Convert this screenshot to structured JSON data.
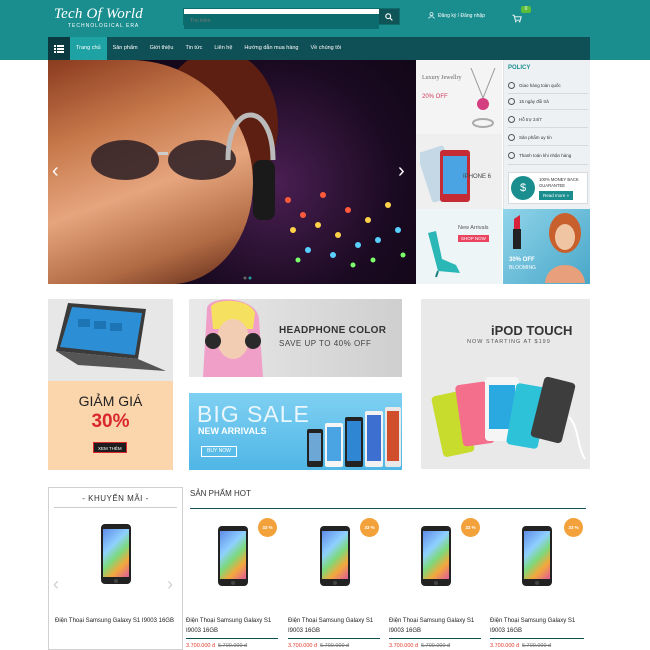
{
  "header": {
    "logo_title": "Tech Of World",
    "logo_subtitle": "TECHNOLOGICAL ERA",
    "search_placeholder": "Tìm kiếm",
    "account_text": "Đăng ký / Đăng nhập",
    "cart_count": "0"
  },
  "nav": {
    "items": [
      {
        "label": "Trang chủ"
      },
      {
        "label": "Sản phẩm"
      },
      {
        "label": "Giới thiệu"
      },
      {
        "label": "Tin tức"
      },
      {
        "label": "Liên hệ"
      },
      {
        "label": "Hướng dẫn mua hàng"
      },
      {
        "label": "Về chúng tôi"
      }
    ]
  },
  "side_banners": {
    "jewelry_title": "Luxury Jewellry",
    "jewelry_offer": "20% OFF",
    "iphone_label": "IPHONE 6",
    "new_arrivals": "New Arrivals",
    "shop_now": "SHOP NOW",
    "lipstick_offer": "30% OFF",
    "lipstick_label": "BLOOMING"
  },
  "policy": {
    "title": "POLICY",
    "items": [
      {
        "label": "Giao hàng toàn quốc"
      },
      {
        "label": "15 ngày đổi trả"
      },
      {
        "label": "Hỗ trợ 24/7"
      },
      {
        "label": "Sản phẩm uy tín"
      },
      {
        "label": "Thanh toán khi nhận hàng"
      }
    ],
    "guarantee_line1": "100% MONEY BACK",
    "guarantee_line2": "GUARANTEE",
    "read_more": "Read more »"
  },
  "promo": {
    "discount_title": "GIẢM GIÁ",
    "discount_percent": "30%",
    "discount_button": "XEM THÊM",
    "headphone_title": "HEADPHONE COLOR",
    "headphone_sub": "SAVE UP TO 40% OFF",
    "bigsale_title": "BIG SALE",
    "bigsale_sub": "NEW ARRIVALS",
    "bigsale_button": "BUY NOW",
    "ipod_title": "iPOD TOUCH",
    "ipod_sub": "NOW STARTING AT $199"
  },
  "sections": {
    "promo_title": "- KHUYẾN MÃI -",
    "hot_title": "SẢN PHẨM HOT"
  },
  "products": {
    "promo_item": {
      "name": "Điện Thoại Samsung Galaxy S1 I9003 16GB"
    },
    "hot_items": [
      {
        "name": "Điện Thoại Samsung Galaxy S1 I9003 16GB",
        "badge": "33 %",
        "price": "3.700.000 đ",
        "old_price": "5.700.000 đ"
      },
      {
        "name": "Điện Thoại Samsung Galaxy S1 I9003 16GB",
        "badge": "33 %",
        "price": "3.700.000 đ",
        "old_price": "5.700.000 đ"
      },
      {
        "name": "Điện Thoại Samsung Galaxy S1 I9003 16GB",
        "badge": "33 %",
        "price": "3.700.000 đ",
        "old_price": "5.700.000 đ"
      },
      {
        "name": "Điện Thoại Samsung Galaxy S1 I9003 16GB",
        "badge": "33 %",
        "price": "3.700.000 đ",
        "old_price": "5.700.000 đ"
      }
    ]
  },
  "colors": {
    "brand": "#1a8e8f",
    "nav": "#0f4f56",
    "accent_price": "#e03c2c",
    "badge": "#f3a23b"
  }
}
